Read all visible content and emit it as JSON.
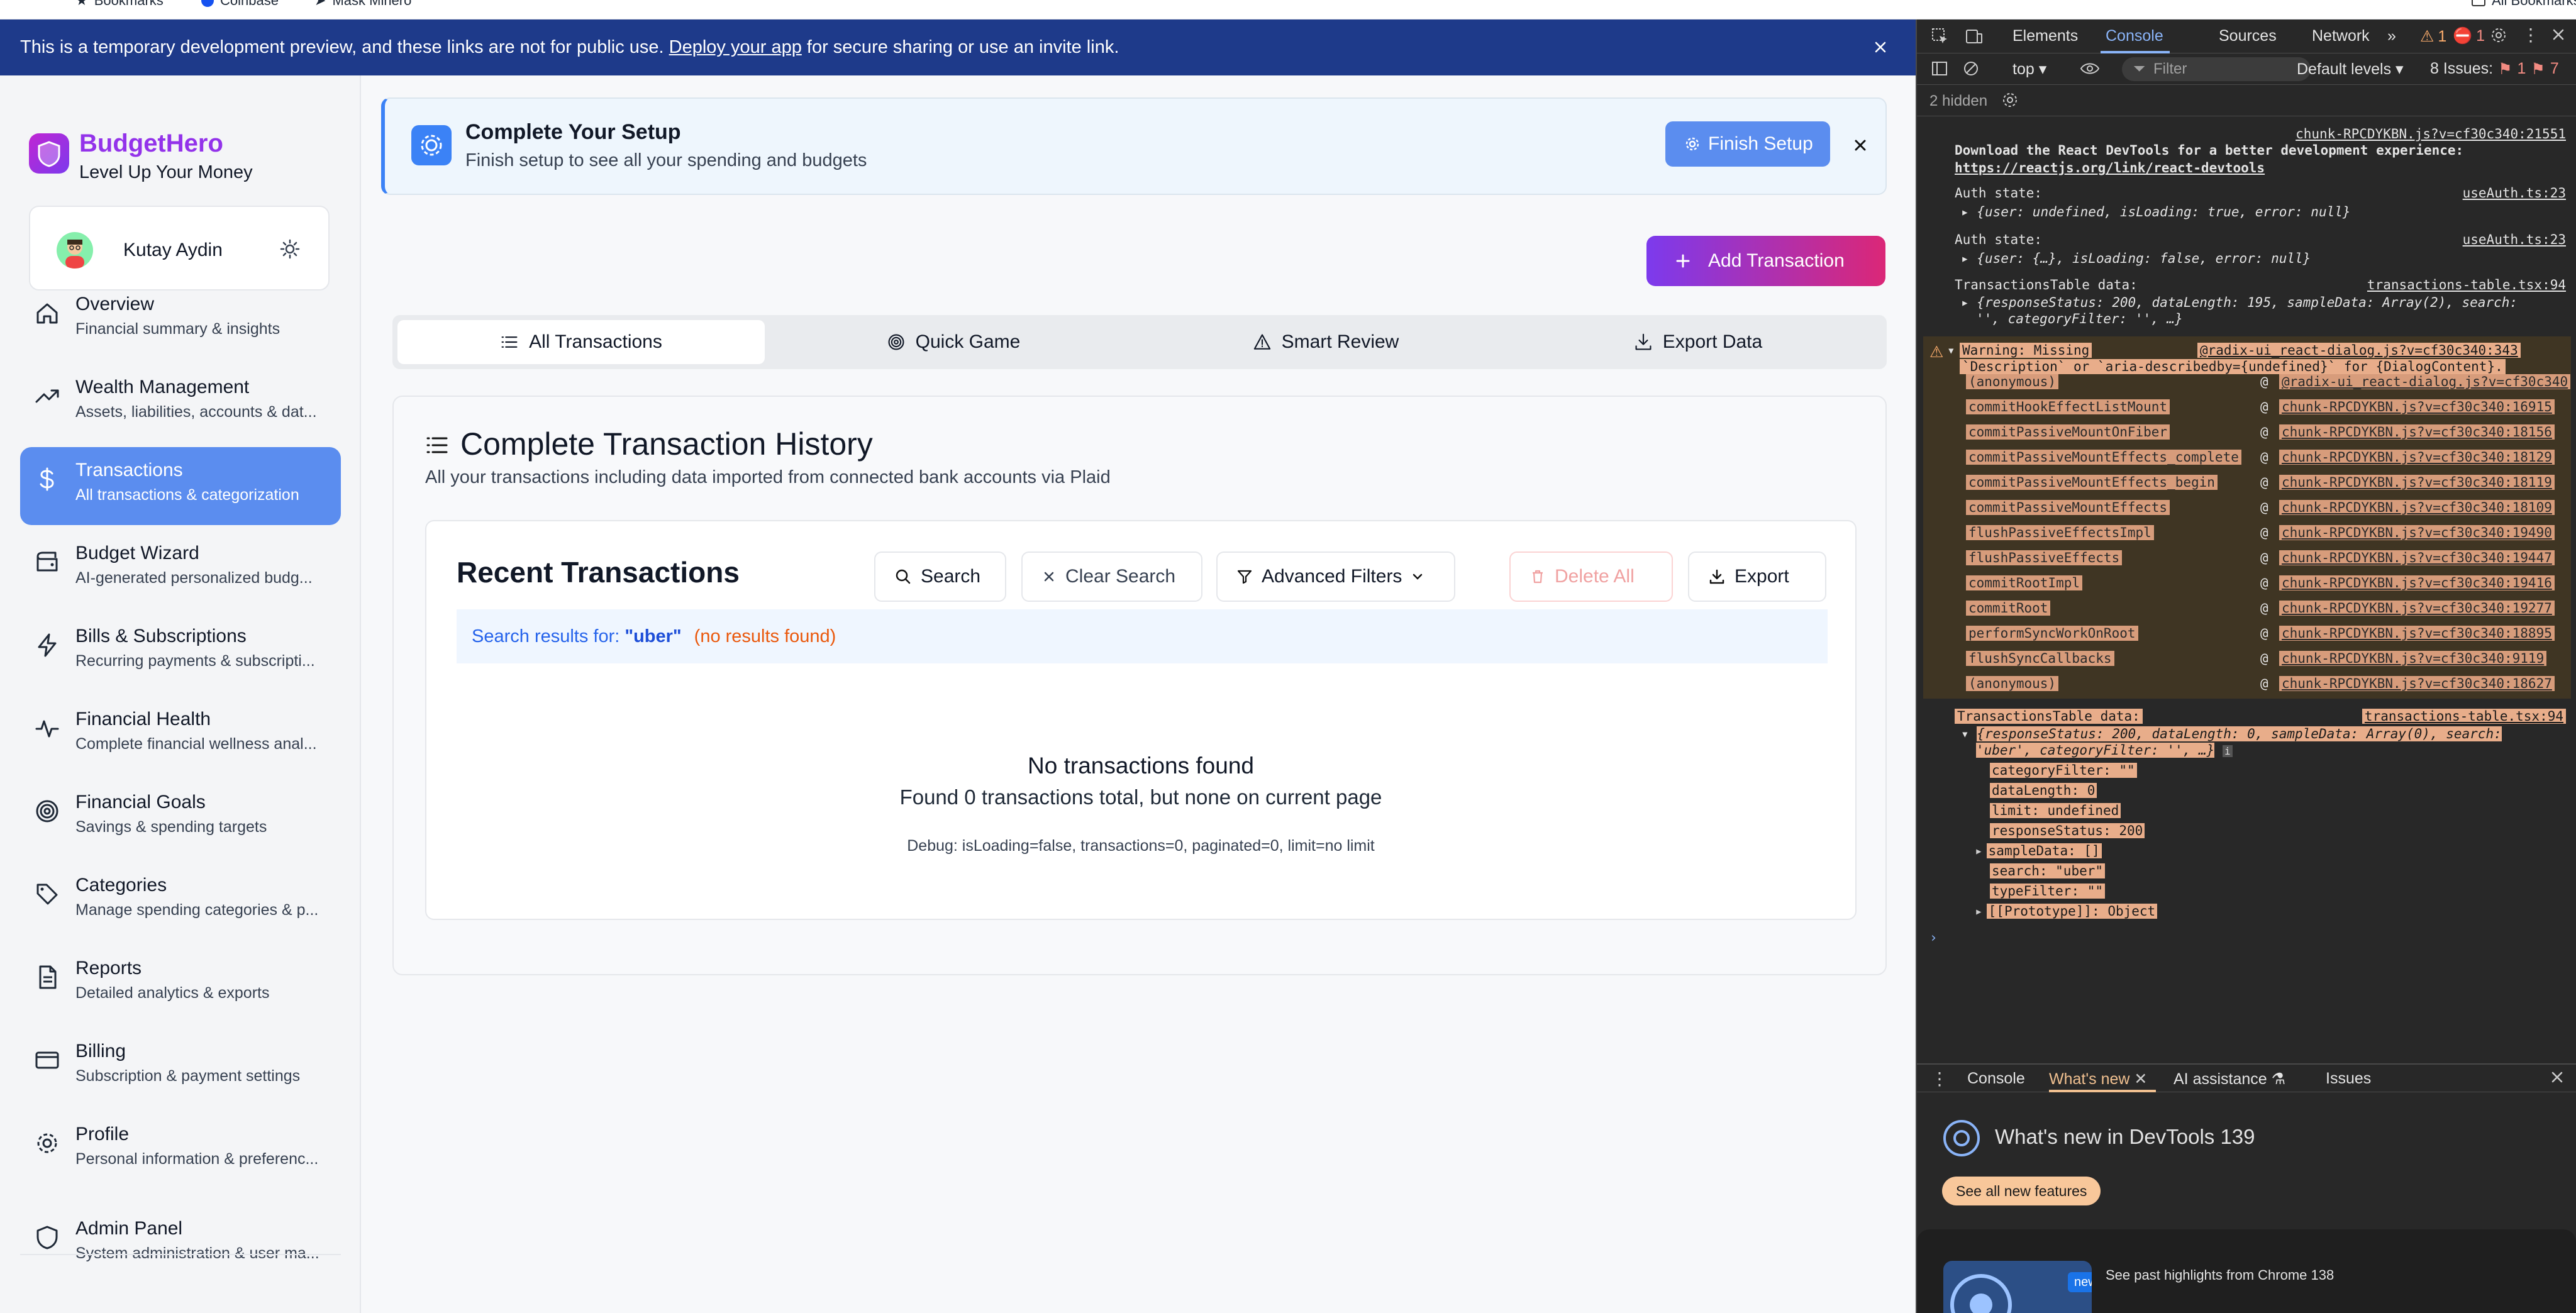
{
  "browser": {
    "bookmarks": [
      {
        "label": "Bookmarks"
      },
      {
        "label": "Coinbase"
      },
      {
        "label": "Mask Minero"
      }
    ],
    "all_bookmarks": "All Bookmarks"
  },
  "banner": {
    "text_before": "This is a temporary development preview, and these links are not for public use.",
    "link": "Deploy your app",
    "text_after": "for secure sharing or use an invite link."
  },
  "brand": {
    "name": "BudgetHero",
    "tagline": "Level Up Your Money"
  },
  "user": {
    "name": "Kutay Aydin"
  },
  "nav": [
    {
      "title": "Overview",
      "sub": "Financial summary & insights",
      "icon": "home-icon"
    },
    {
      "title": "Wealth Management",
      "sub": "Assets, liabilities, accounts & dat...",
      "icon": "trending-up-icon"
    },
    {
      "title": "Transactions",
      "sub": "All transactions & categorization",
      "icon": "dollar-icon",
      "active": true
    },
    {
      "title": "Budget Wizard",
      "sub": "AI-generated personalized budg...",
      "icon": "budget-icon"
    },
    {
      "title": "Bills & Subscriptions",
      "sub": "Recurring payments & subscripti...",
      "icon": "zap-icon"
    },
    {
      "title": "Financial Health",
      "sub": "Complete financial wellness anal...",
      "icon": "pulse-icon"
    },
    {
      "title": "Financial Goals",
      "sub": "Savings & spending targets",
      "icon": "target-icon"
    },
    {
      "title": "Categories",
      "sub": "Manage spending categories & p...",
      "icon": "tag-icon"
    },
    {
      "title": "Reports",
      "sub": "Detailed analytics & exports",
      "icon": "document-icon"
    },
    {
      "title": "Billing",
      "sub": "Subscription & payment settings",
      "icon": "credit-card-icon"
    },
    {
      "title": "Profile",
      "sub": "Personal information & preferenc...",
      "icon": "gear-icon"
    },
    {
      "title": "Admin Panel",
      "sub": "System administration & user ma...",
      "icon": "shield-icon"
    }
  ],
  "setup": {
    "title": "Complete Your Setup",
    "desc": "Finish setup to see all your spending and budgets",
    "button": "Finish Setup"
  },
  "add_transaction": "Add Transaction",
  "tabs": [
    {
      "label": "All Transactions",
      "icon": "list-icon",
      "active": true
    },
    {
      "label": "Quick Game",
      "icon": "target-icon"
    },
    {
      "label": "Smart Review",
      "icon": "warning-icon"
    },
    {
      "label": "Export Data",
      "icon": "download-icon"
    }
  ],
  "history": {
    "title": "Complete Transaction History",
    "desc": "All your transactions including data imported from connected bank accounts via Plaid"
  },
  "recent": {
    "title": "Recent Transactions",
    "buttons": {
      "search": "Search",
      "clear": "Clear Search",
      "filters": "Advanced Filters",
      "delete_all": "Delete All",
      "export": "Export"
    },
    "search_info": {
      "label": "Search results for:",
      "query": "\"uber\"",
      "status": "(no results found)"
    },
    "empty_title": "No transactions found",
    "empty_sub": "Found 0 transactions total, but none on current page",
    "debug": "Debug: isLoading=false, transactions=0, paginated=0, limit=no limit"
  },
  "devtools": {
    "tabs": [
      "Elements",
      "Console",
      "Sources",
      "Network"
    ],
    "warn_count": "1",
    "err_count": "1",
    "context": "top",
    "filter_placeholder": "Filter",
    "levels": "Default levels",
    "issues_label": "8 Issues:",
    "issues_err": "1",
    "issues_info": "7",
    "hidden": "2 hidden",
    "messages": {
      "react_src": "chunk-RPCDYKBN.js?v=cf30c340:21551",
      "react_msg": "Download the React DevTools for a better development experience:",
      "react_link": "https://reactjs.org/link/react-devtools",
      "auth1_label": "Auth state:",
      "auth1_src": "useAuth.ts:23",
      "auth1_obj": "{user: undefined, isLoading: true, error: null}",
      "auth2_label": "Auth state:",
      "auth2_src": "useAuth.ts:23",
      "auth2_obj": "{user: {…}, isLoading: false, error: null}",
      "tt1_label": "TransactionsTable data:",
      "tt1_src": "transactions-table.tsx:94",
      "tt1_obj_a": "{responseStatus: 200, dataLength: 195, sampleData: Array(2), search:",
      "tt1_obj_b": "'', categoryFilter: '', …}",
      "warn_title": "Warning: Missing",
      "warn_src": "@radix-ui_react-dialog.js?v=cf30c340:343",
      "warn_line2": "`Description` or `aria-describedby={undefined}` for {DialogContent}.",
      "tt2_label": "TransactionsTable data:",
      "tt2_src": "transactions-table.tsx:94",
      "tt2_obj_a": "{responseStatus: 200, dataLength: 0, sampleData: Array(0), search:",
      "tt2_obj_b": "'uber', categoryFilter: '', …}",
      "props": [
        {
          "k": "categoryFilter",
          "v": "\"\""
        },
        {
          "k": "dataLength",
          "v": "0"
        },
        {
          "k": "limit",
          "v": "undefined"
        },
        {
          "k": "responseStatus",
          "v": "200"
        },
        {
          "k": "sampleData",
          "v": "[]"
        },
        {
          "k": "search",
          "v": "\"uber\""
        },
        {
          "k": "typeFilter",
          "v": "\"\""
        },
        {
          "k": "[[Prototype]]",
          "v": "Object"
        }
      ]
    },
    "stack": [
      {
        "fn": "(anonymous)",
        "src": "@radix-ui_react-dialog.js?v=cf30c340"
      },
      {
        "fn": "commitHookEffectListMount",
        "src": "chunk-RPCDYKBN.js?v=cf30c340:16915"
      },
      {
        "fn": "commitPassiveMountOnFiber",
        "src": "chunk-RPCDYKBN.js?v=cf30c340:18156"
      },
      {
        "fn": "commitPassiveMountEffects_complete",
        "src": "chunk-RPCDYKBN.js?v=cf30c340:18129"
      },
      {
        "fn": "commitPassiveMountEffects_begin",
        "src": "chunk-RPCDYKBN.js?v=cf30c340:18119"
      },
      {
        "fn": "commitPassiveMountEffects",
        "src": "chunk-RPCDYKBN.js?v=cf30c340:18109"
      },
      {
        "fn": "flushPassiveEffectsImpl",
        "src": "chunk-RPCDYKBN.js?v=cf30c340:19490"
      },
      {
        "fn": "flushPassiveEffects",
        "src": "chunk-RPCDYKBN.js?v=cf30c340:19447"
      },
      {
        "fn": "commitRootImpl",
        "src": "chunk-RPCDYKBN.js?v=cf30c340:19416"
      },
      {
        "fn": "commitRoot",
        "src": "chunk-RPCDYKBN.js?v=cf30c340:19277"
      },
      {
        "fn": "performSyncWorkOnRoot",
        "src": "chunk-RPCDYKBN.js?v=cf30c340:18895"
      },
      {
        "fn": "flushSyncCallbacks",
        "src": "chunk-RPCDYKBN.js?v=cf30c340:9119"
      },
      {
        "fn": "(anonymous)",
        "src": "chunk-RPCDYKBN.js?v=cf30c340:18627"
      }
    ],
    "drawer": {
      "tabs": [
        "Console",
        "What's new",
        "AI assistance",
        "Issues"
      ],
      "whats_new_title": "What's new in DevTools 139",
      "see_all": "See all new features",
      "new_badge": "new",
      "past_highlights": "See past highlights from Chrome 138"
    }
  }
}
